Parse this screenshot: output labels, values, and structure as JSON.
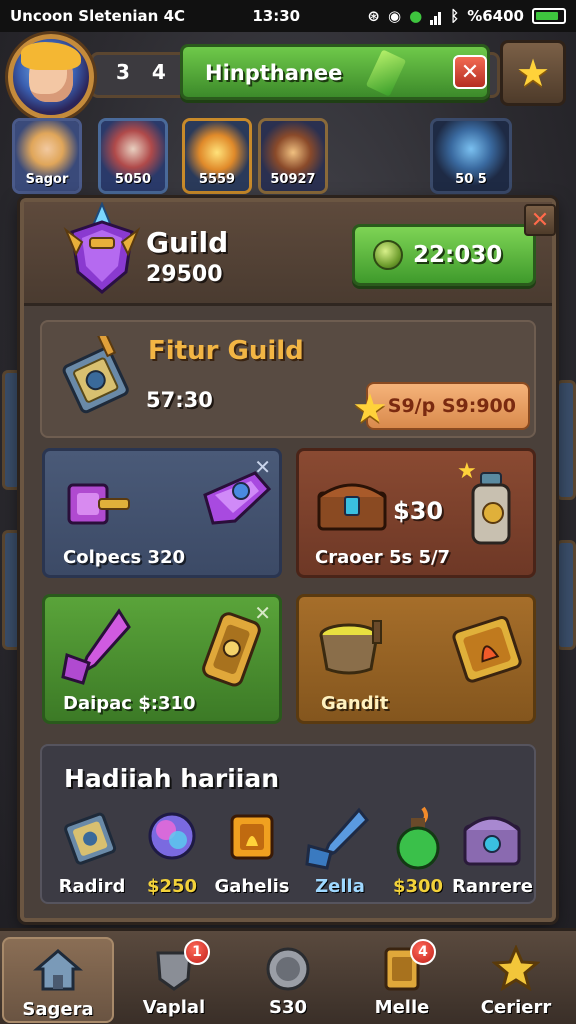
{
  "status_bar": {
    "carrier": "Uncoon Sletenian 4C",
    "time": "13:30",
    "battery_text": "%6400"
  },
  "hud": {
    "stat_1": "3",
    "stat_2": "4",
    "title": "Hinpthanee"
  },
  "heroes": [
    {
      "label": "Sagor"
    },
    {
      "label": "5050"
    },
    {
      "label": "5559"
    },
    {
      "label": "50927"
    },
    {
      "label": "50 5"
    }
  ],
  "guild": {
    "title": "Guild",
    "subtitle": "29500",
    "timer": "22:030"
  },
  "feature": {
    "title": "Fitur Guild",
    "price": "57:30",
    "pill": "S9/p S9:900"
  },
  "cards": {
    "blue_label": "Colpecs 320",
    "brown_big": "$30",
    "brown_label": "Craoer 5s 5/7",
    "green_label": "Daipac $:310",
    "gold_label": "Gandit"
  },
  "daily": {
    "title": "Hadiiah hariian",
    "rewards": [
      {
        "label": "Radird",
        "color": "#ffffff"
      },
      {
        "label": "$250",
        "color": "#f3d23a"
      },
      {
        "label": "Gahelis",
        "color": "#ffffff"
      },
      {
        "label": "Zella",
        "color": "#9fd8ff"
      },
      {
        "label": "$300",
        "color": "#f3d23a"
      },
      {
        "label": "Ranrere",
        "color": "#ffffff"
      }
    ]
  },
  "nav": {
    "items": [
      {
        "label": "Sagera",
        "icon": "home-icon"
      },
      {
        "label": "Vaplal",
        "icon": "shield-icon",
        "badge": "1"
      },
      {
        "label": "S30",
        "icon": "coin-icon"
      },
      {
        "label": "Melle",
        "icon": "card-icon",
        "badge": "4"
      },
      {
        "label": "Cerierr",
        "icon": "star-icon"
      }
    ]
  },
  "colors": {
    "accent_green": "#4fae34",
    "accent_gold": "#f2b544",
    "badge_red": "#d7261c"
  }
}
